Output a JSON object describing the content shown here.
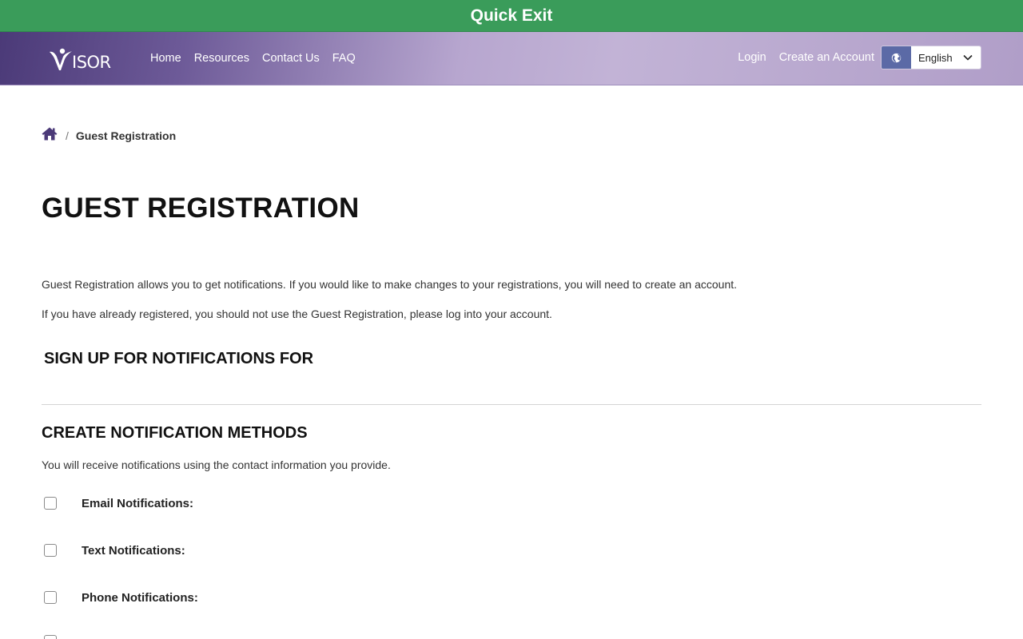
{
  "quick_exit": {
    "label": "Quick Exit",
    "color": "#3a9c5a"
  },
  "header": {
    "logo": {
      "text": "ISOR",
      "icon": "visor-person-v-logo"
    },
    "nav": [
      {
        "label": "Home"
      },
      {
        "label": "Resources"
      },
      {
        "label": "Contact Us"
      },
      {
        "label": "FAQ"
      }
    ],
    "right": {
      "login": "Login",
      "create_account": "Create an Account",
      "language": {
        "icon": "globe-icon",
        "selected": "English"
      }
    }
  },
  "breadcrumb": {
    "home_icon": "home-icon",
    "separator": "/",
    "current": "Guest Registration"
  },
  "main": {
    "title": "GUEST REGISTRATION",
    "intro": [
      "Guest Registration allows you to get notifications. If you would like to make changes to your registrations, you will need to create an account.",
      "If you have already registered, you should not use the Guest Registration, please log into your account."
    ],
    "signup_heading": "SIGN UP FOR NOTIFICATIONS FOR",
    "methods": {
      "heading": "CREATE NOTIFICATION METHODS",
      "description": "You will receive notifications using the contact information you provide.",
      "options": [
        {
          "label": "Email Notifications:",
          "checked": false
        },
        {
          "label": "Text Notifications:",
          "checked": false
        },
        {
          "label": "Phone Notifications:",
          "checked": false
        }
      ]
    }
  },
  "colors": {
    "brand_purple": "#4b3a78",
    "globe_button": "#5b6aa6"
  }
}
